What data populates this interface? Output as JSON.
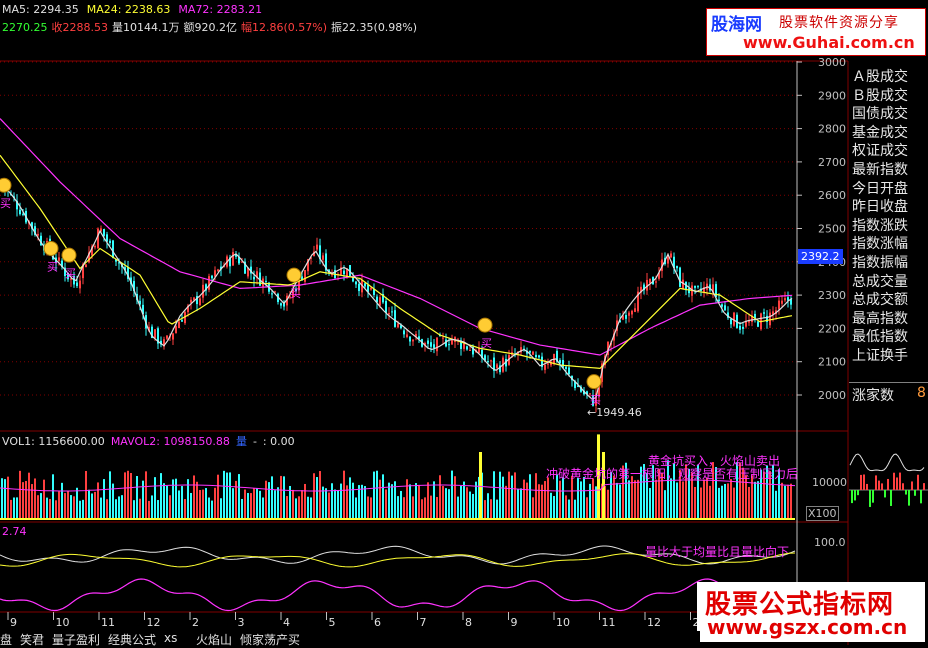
{
  "header": {
    "line1": [
      {
        "text": "MA5: 2294.35",
        "color": "#e0e0e0"
      },
      {
        "text": "MA24: 2238.63",
        "color": "#ffff33"
      },
      {
        "text": "MA72: 2283.21",
        "color": "#ff33ff"
      }
    ],
    "line2": [
      {
        "text": "2270.25",
        "color": "#33ff33"
      },
      {
        "text": "收2288.53",
        "color": "#ff4040"
      },
      {
        "text": "量10144.1万",
        "color": "#e0e0e0"
      },
      {
        "text": "额920.2亿",
        "color": "#e0e0e0"
      },
      {
        "text": "幅12.86(0.57%)",
        "color": "#ff4040"
      },
      {
        "text": "振22.35(0.98%)",
        "color": "#e0e0e0"
      }
    ]
  },
  "volume_header": [
    {
      "text": "VOL1: 1156600.00",
      "color": "#e0e0e0"
    },
    {
      "text": "MAVOL2: 1098150.88",
      "color": "#ff33ff"
    },
    {
      "text": "量",
      "color": "#3366ff"
    },
    {
      "text": "-",
      "color": "#e0e0e0"
    },
    {
      "text": ": 0.00",
      "color": "#e0e0e0"
    }
  ],
  "indicator_header": {
    "text": "2.74",
    "color": "#ff33ff"
  },
  "price_axis_labels": [
    "3000",
    "2900",
    "2800",
    "2700",
    "2600",
    "2500",
    "2400",
    "2300",
    "2200",
    "2100",
    "2000"
  ],
  "current_price_tag": "2392.2",
  "low_annotation": "←1949.46",
  "volume_axis_label": "10000",
  "volume_multiplier": "X100",
  "indicator_axis_label": "100.0",
  "signal_labels": {
    "buy": "买",
    "volume_signals": [
      "黄金坑买入，火焰山卖出",
      "冲破黄金坑的第一根阳，观察是否有压制压力后"
    ],
    "indicator_signal": "量比大于均量比且量比向下"
  },
  "date_labels": [
    "9",
    "10",
    "11",
    "12",
    "2",
    "3",
    "4",
    "5",
    "6",
    "7",
    "8",
    "9",
    "10",
    "11",
    "12",
    "2",
    "3"
  ],
  "right_panel": {
    "items": [
      "Ａ股成交",
      "Ｂ股成交",
      "国债成交",
      "基金成交",
      "权证成交",
      "最新指数",
      "今日开盘",
      "昨日收盘",
      "指数涨跌",
      "指数涨幅",
      "指数振幅",
      "总成交量",
      "总成交额",
      "最高指数",
      "最低指数",
      "上证换手"
    ],
    "breadth_label": "涨家数",
    "breadth_value": "8"
  },
  "watermark_top": {
    "brand": "股海网",
    "tagline": "股票软件资源分享",
    "url": "www.Guhai.com.cn"
  },
  "watermark_bottom": {
    "title": "股票公式指标网",
    "url": "www.gszx.com.cn"
  },
  "toolbar": [
    "盘",
    "笑君",
    "量子盈利",
    "经典公式",
    "xs",
    "火焰山",
    "倾家荡产买"
  ],
  "colors": {
    "up": "#ff4040",
    "down": "#33ffff",
    "ma5": "#e0e0e0",
    "ma24": "#ffff33",
    "ma72": "#ff33ff",
    "grid": "#800000",
    "axis": "#c0c0c0"
  },
  "chart_data": {
    "type": "candlestick",
    "ylim": [
      1900,
      3050
    ],
    "grid": true,
    "price_anchors": [
      [
        0,
        2640
      ],
      [
        20,
        2560
      ],
      [
        40,
        2470
      ],
      [
        60,
        2390
      ],
      [
        75,
        2330
      ],
      [
        85,
        2400
      ],
      [
        100,
        2500
      ],
      [
        115,
        2420
      ],
      [
        130,
        2340
      ],
      [
        150,
        2190
      ],
      [
        165,
        2150
      ],
      [
        180,
        2230
      ],
      [
        200,
        2300
      ],
      [
        220,
        2380
      ],
      [
        235,
        2420
      ],
      [
        250,
        2370
      ],
      [
        270,
        2330
      ],
      [
        285,
        2270
      ],
      [
        300,
        2350
      ],
      [
        315,
        2440
      ],
      [
        330,
        2370
      ],
      [
        345,
        2380
      ],
      [
        360,
        2330
      ],
      [
        375,
        2290
      ],
      [
        390,
        2240
      ],
      [
        410,
        2180
      ],
      [
        430,
        2140
      ],
      [
        450,
        2170
      ],
      [
        465,
        2150
      ],
      [
        480,
        2120
      ],
      [
        495,
        2080
      ],
      [
        510,
        2110
      ],
      [
        525,
        2130
      ],
      [
        540,
        2090
      ],
      [
        555,
        2120
      ],
      [
        570,
        2050
      ],
      [
        585,
        2000
      ],
      [
        595,
        1980
      ],
      [
        605,
        2120
      ],
      [
        620,
        2230
      ],
      [
        640,
        2300
      ],
      [
        655,
        2350
      ],
      [
        668,
        2430
      ],
      [
        680,
        2340
      ],
      [
        695,
        2300
      ],
      [
        710,
        2330
      ],
      [
        725,
        2250
      ],
      [
        740,
        2210
      ],
      [
        755,
        2220
      ],
      [
        770,
        2240
      ],
      [
        790,
        2290
      ]
    ],
    "ma24_anchors": [
      [
        0,
        2720
      ],
      [
        40,
        2560
      ],
      [
        80,
        2380
      ],
      [
        100,
        2440
      ],
      [
        140,
        2360
      ],
      [
        170,
        2210
      ],
      [
        200,
        2260
      ],
      [
        240,
        2340
      ],
      [
        290,
        2330
      ],
      [
        320,
        2370
      ],
      [
        360,
        2350
      ],
      [
        400,
        2260
      ],
      [
        440,
        2180
      ],
      [
        480,
        2140
      ],
      [
        520,
        2120
      ],
      [
        560,
        2090
      ],
      [
        600,
        2080
      ],
      [
        640,
        2200
      ],
      [
        680,
        2320
      ],
      [
        720,
        2300
      ],
      [
        760,
        2220
      ],
      [
        795,
        2240
      ]
    ],
    "ma72_anchors": [
      [
        0,
        2830
      ],
      [
        60,
        2640
      ],
      [
        120,
        2470
      ],
      [
        180,
        2370
      ],
      [
        240,
        2320
      ],
      [
        300,
        2330
      ],
      [
        360,
        2360
      ],
      [
        420,
        2290
      ],
      [
        480,
        2200
      ],
      [
        540,
        2150
      ],
      [
        600,
        2120
      ],
      [
        650,
        2200
      ],
      [
        700,
        2270
      ],
      [
        750,
        2290
      ],
      [
        795,
        2300
      ]
    ],
    "buy_markers": [
      {
        "x": 0,
        "price": 2630
      },
      {
        "x": 47,
        "price": 2440
      },
      {
        "x": 65,
        "price": 2420
      },
      {
        "x": 290,
        "price": 2360
      },
      {
        "x": 481,
        "price": 2210
      },
      {
        "x": 590,
        "price": 2040
      }
    ],
    "low": 1949.46
  }
}
